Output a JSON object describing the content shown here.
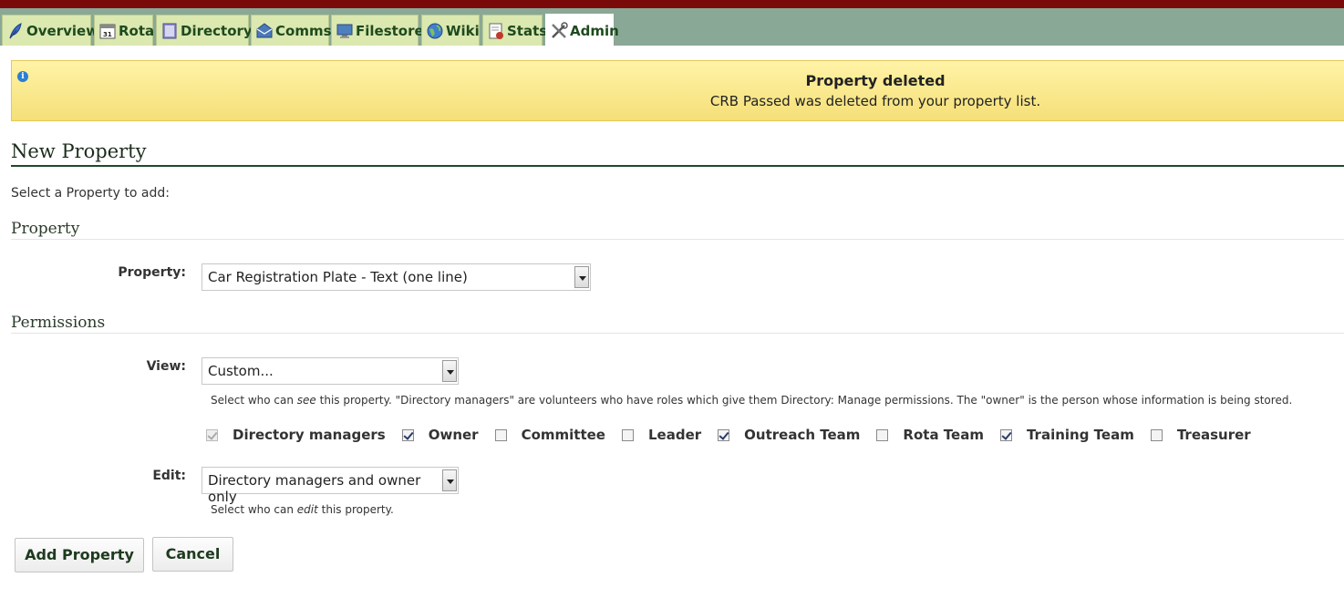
{
  "tabs": [
    {
      "label": "Overview",
      "icon": "feather-icon"
    },
    {
      "label": "Rota",
      "icon": "calendar-icon"
    },
    {
      "label": "Directory",
      "icon": "address-book-icon"
    },
    {
      "label": "Comms",
      "icon": "mail-icon"
    },
    {
      "label": "Filestore",
      "icon": "monitor-icon"
    },
    {
      "label": "Wiki",
      "icon": "globe-icon"
    },
    {
      "label": "Stats",
      "icon": "report-icon"
    },
    {
      "label": "Admin",
      "icon": "tools-icon"
    }
  ],
  "active_tab": "Admin",
  "banner": {
    "title": "Property deleted",
    "message": "CRB Passed was deleted from your property list."
  },
  "page_title": "New Property",
  "intro": "Select a Property to add:",
  "property_section": {
    "heading": "Property",
    "label": "Property:",
    "selected": "Car Registration Plate - Text (one line)"
  },
  "permissions_section": {
    "heading": "Permissions",
    "view_label": "View:",
    "view_selected": "Custom...",
    "view_help_pre": "Select who can ",
    "view_help_em": "see",
    "view_help_post": " this property. \"Directory managers\" are volunteers who have roles which give them Directory: Manage permissions. The \"owner\" is the person whose information is being stored.",
    "groups": [
      {
        "label": "Directory managers",
        "checked": true,
        "disabled": true
      },
      {
        "label": "Owner",
        "checked": true,
        "disabled": false
      },
      {
        "label": "Committee",
        "checked": false,
        "disabled": false
      },
      {
        "label": "Leader",
        "checked": false,
        "disabled": false
      },
      {
        "label": "Outreach Team",
        "checked": true,
        "disabled": false
      },
      {
        "label": "Rota Team",
        "checked": false,
        "disabled": false
      },
      {
        "label": "Training Team",
        "checked": true,
        "disabled": false
      },
      {
        "label": "Treasurer",
        "checked": false,
        "disabled": false
      }
    ],
    "edit_label": "Edit:",
    "edit_selected": "Directory managers and owner only",
    "edit_help_pre": "Select who can ",
    "edit_help_em": "edit",
    "edit_help_post": " this property."
  },
  "buttons": {
    "add": "Add Property",
    "cancel": "Cancel"
  },
  "colors": {
    "top_bar": "#7a0a0a",
    "tab_bar": "#8aa896",
    "tab": "#dbe8b0",
    "banner": "#fff3a6",
    "heading_rule": "#1d4a2a"
  }
}
